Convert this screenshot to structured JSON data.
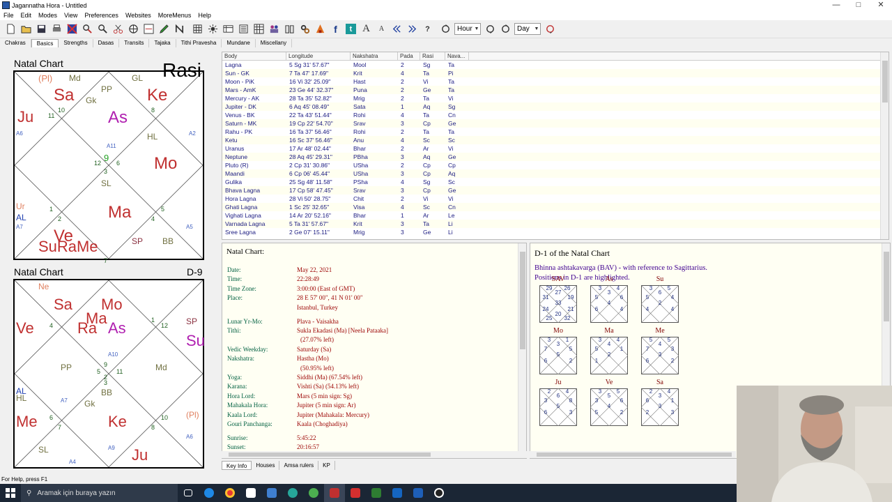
{
  "window": {
    "title": "Jagannatha Hora - Untitled",
    "controls": [
      "—",
      "□",
      "✕"
    ]
  },
  "menu": [
    "File",
    "Edit",
    "Modes",
    "View",
    "Preferences",
    "Websites",
    "MoreMenus",
    "Help"
  ],
  "toolbar": {
    "hour_combo": "Hour",
    "day_combo": "Day",
    "font_big": "A",
    "font_small": "A",
    "facebook": "f",
    "twitter": "t",
    "help": "?"
  },
  "tabs": [
    "Chakras",
    "Basics",
    "Strengths",
    "Dasas",
    "Transits",
    "Tajaka",
    "Tithi Pravesha",
    "Mundane",
    "Miscellany"
  ],
  "active_tab": "Basics",
  "chart1": {
    "title": "Natal Chart",
    "label": "Rasi",
    "planets": [
      {
        "t": "(Pl)",
        "c": "#e08060",
        "s": 13
      },
      {
        "t": "Md",
        "c": "#707040",
        "s": 12
      },
      {
        "t": "GL",
        "c": "#707040",
        "s": 12
      },
      {
        "t": "Sa",
        "c": "#c03030",
        "s": 24
      },
      {
        "t": "PP",
        "c": "#707040",
        "s": 12
      },
      {
        "t": "Ke",
        "c": "#c03030",
        "s": 24
      },
      {
        "t": "Gk",
        "c": "#707040",
        "s": 12
      },
      {
        "t": "As",
        "c": "#b020b0",
        "s": 24
      },
      {
        "t": "Ju",
        "c": "#c03030",
        "s": 22
      },
      {
        "t": "HL",
        "c": "#707040",
        "s": 12
      },
      {
        "t": "Mo",
        "c": "#c03030",
        "s": 24
      },
      {
        "t": "SL",
        "c": "#707040",
        "s": 12
      },
      {
        "t": "Ur",
        "c": "#e08060",
        "s": 12
      },
      {
        "t": "AL",
        "c": "#2040b0",
        "s": 12
      },
      {
        "t": "Ma",
        "c": "#c03030",
        "s": 24
      },
      {
        "t": "Ve",
        "c": "#c03030",
        "s": 24
      },
      {
        "t": "SuRaMe",
        "c": "#c03030",
        "s": 22
      },
      {
        "t": "SP",
        "c": "#8a3040",
        "s": 12
      },
      {
        "t": "BB",
        "c": "#707040",
        "s": 12
      },
      {
        "t": "A7",
        "c": "#4060c0",
        "s": 8
      },
      {
        "t": "A5",
        "c": "#4060c0",
        "s": 8
      },
      {
        "t": "A2",
        "c": "#4060c0",
        "s": 8
      },
      {
        "t": "A6",
        "c": "#4060c0",
        "s": 8
      },
      {
        "t": "A11",
        "c": "#4060c0",
        "s": 8
      }
    ],
    "houses": [
      "10",
      "11",
      "9",
      "12",
      "3",
      "6",
      "8",
      "1",
      "2",
      "4",
      "5",
      "7"
    ]
  },
  "chart2": {
    "title": "Natal Chart",
    "label": "D-9",
    "planets": [
      {
        "t": "Ne",
        "c": "#e08060",
        "s": 12
      },
      {
        "t": "Sa",
        "c": "#c03030",
        "s": 22
      },
      {
        "t": "Mo",
        "c": "#c03030",
        "s": 22
      },
      {
        "t": "Ma",
        "c": "#c03030",
        "s": 22
      },
      {
        "t": "Ve",
        "c": "#c03030",
        "s": 22
      },
      {
        "t": "Ra",
        "c": "#c03030",
        "s": 22
      },
      {
        "t": "As",
        "c": "#b020b0",
        "s": 22
      },
      {
        "t": "SP",
        "c": "#8a3040",
        "s": 12
      },
      {
        "t": "Su",
        "c": "#b020b0",
        "s": 22
      },
      {
        "t": "PP",
        "c": "#707040",
        "s": 12
      },
      {
        "t": "Md",
        "c": "#707040",
        "s": 12
      },
      {
        "t": "AL",
        "c": "#2040b0",
        "s": 12
      },
      {
        "t": "HL",
        "c": "#707040",
        "s": 12
      },
      {
        "t": "BB",
        "c": "#707040",
        "s": 12
      },
      {
        "t": "Gk",
        "c": "#707040",
        "s": 12
      },
      {
        "t": "Me",
        "c": "#c03030",
        "s": 22
      },
      {
        "t": "Ke",
        "c": "#c03030",
        "s": 22
      },
      {
        "t": "(Pl)",
        "c": "#e08060",
        "s": 12
      },
      {
        "t": "SL",
        "c": "#707040",
        "s": 12
      },
      {
        "t": "Ju",
        "c": "#c03030",
        "s": 22
      },
      {
        "t": "A10",
        "c": "#4060c0",
        "s": 8
      },
      {
        "t": "A7",
        "c": "#4060c0",
        "s": 8
      },
      {
        "t": "A9",
        "c": "#4060c0",
        "s": 8
      },
      {
        "t": "A4",
        "c": "#4060c0",
        "s": 8
      },
      {
        "t": "A6",
        "c": "#4060c0",
        "s": 8
      }
    ],
    "houses": [
      "4",
      "1",
      "12",
      "5",
      "2",
      "11",
      "8",
      "9",
      "6",
      "10",
      "7",
      "3"
    ]
  },
  "table": {
    "headers": [
      "Body",
      "Longitude",
      "Nakshatra",
      "Pada",
      "Rasi",
      "Nava..."
    ],
    "rows": [
      [
        "Lagna",
        "5 Sg 31' 57.67\"",
        "Mool",
        "2",
        "Sg",
        "Ta"
      ],
      [
        "Sun - GK",
        "7 Ta 47' 17.69\"",
        "Krit",
        "4",
        "Ta",
        "Pi"
      ],
      [
        "Moon - PiK",
        "16 Vi 32' 25.09\"",
        "Hast",
        "2",
        "Vi",
        "Ta"
      ],
      [
        "Mars - AmK",
        "23 Ge 44' 32.37\"",
        "Puna",
        "2",
        "Ge",
        "Ta"
      ],
      [
        "Mercury - AK",
        "28 Ta 35' 52.82\"",
        "Mrig",
        "2",
        "Ta",
        "Vi"
      ],
      [
        "Jupiter - DK",
        "6 Aq 45' 08.49\"",
        "Sata",
        "1",
        "Aq",
        "Sg"
      ],
      [
        "Venus - BK",
        "22 Ta 43' 51.44\"",
        "Rohi",
        "4",
        "Ta",
        "Cn"
      ],
      [
        "Saturn - MK",
        "19 Cp 22' 54.70\"",
        "Srav",
        "3",
        "Cp",
        "Ge"
      ],
      [
        "Rahu - PK",
        "16 Ta 37' 56.46\"",
        "Rohi",
        "2",
        "Ta",
        "Ta"
      ],
      [
        "Ketu",
        "16 Sc 37' 56.46\"",
        "Anu",
        "4",
        "Sc",
        "Sc"
      ],
      [
        "Uranus",
        "17 Ar 48' 02.44\"",
        "Bhar",
        "2",
        "Ar",
        "Vi"
      ],
      [
        "Neptune",
        "28 Aq 45' 29.31\"",
        "PBha",
        "3",
        "Aq",
        "Ge"
      ],
      [
        "Pluto (R)",
        "2 Cp 31' 30.86\"",
        "USha",
        "2",
        "Cp",
        "Cp"
      ],
      [
        "Maandi",
        "6 Cp 06' 45.44\"",
        "USha",
        "3",
        "Cp",
        "Aq"
      ],
      [
        "Gulika",
        "25 Sg 48' 11.58\"",
        "PSha",
        "4",
        "Sg",
        "Sc"
      ],
      [
        "Bhava Lagna",
        "17 Cp 58' 47.45\"",
        "Srav",
        "3",
        "Cp",
        "Ge"
      ],
      [
        "Hora Lagna",
        "28 Vi 50' 28.75\"",
        "Chit",
        "2",
        "Vi",
        "Vi"
      ],
      [
        "Ghati Lagna",
        "1 Sc 25' 32.65\"",
        "Visa",
        "4",
        "Sc",
        "Cn"
      ],
      [
        "Vighati Lagna",
        "14 Ar 20' 52.16\"",
        "Bhar",
        "1",
        "Ar",
        "Le"
      ],
      [
        "Varnada Lagna",
        "5 Ta 31' 57.67\"",
        "Krit",
        "3",
        "Ta",
        "Li"
      ],
      [
        "Sree Lagna",
        "2 Ge 07' 15.11\"",
        "Mrig",
        "3",
        "Ge",
        "Li"
      ]
    ]
  },
  "info": {
    "title": "Natal Chart:",
    "rows": [
      [
        "Date:",
        "May 22, 2021"
      ],
      [
        "Time:",
        "22:28:49"
      ],
      [
        "Time Zone:",
        "3:00:00 (East of GMT)"
      ],
      [
        "Place:",
        "28 E 57' 00\", 41 N 01' 00\""
      ],
      [
        "",
        "Istanbul, Turkey"
      ],
      [
        "Lunar Yr-Mo:",
        "Plava - Vaisakha"
      ],
      [
        "Tithi:",
        "Sukla Ekadasi (Ma) [Neela Pataaka]"
      ],
      [
        "",
        "(27.07% left)"
      ],
      [
        "Vedic Weekday:",
        "Saturday (Sa)"
      ],
      [
        "Nakshatra:",
        "Hastha (Mo)"
      ],
      [
        "",
        "(50.95% left)"
      ],
      [
        "Yoga:",
        "Siddhi (Ma) (67.54% left)"
      ],
      [
        "Karana:",
        "Vishti (Sa) (54.13% left)"
      ],
      [
        "Hora Lord:",
        "Mars (5 min sign: Sg)"
      ],
      [
        "Mahakala Hora:",
        "Jupiter (5 min sign: Ar)"
      ],
      [
        "Kaala Lord:",
        "Jupiter (Mahakala: Mercury)"
      ],
      [
        "Gouri Panchanga:",
        "Kaala (Choghadiya)"
      ],
      [
        "Sunrise:",
        "5:45:22"
      ],
      [
        "Sunset:",
        "20:16:57"
      ]
    ]
  },
  "d1": {
    "title": "D-1 of the Natal Chart",
    "desc1": "Bhinna ashtakavarga (BAV) - with reference to Sagittarius.",
    "desc2": "Positions in D-1 are highlighted.",
    "bav": [
      {
        "label": "SAV",
        "nums": [
          "27",
          "29",
          "26",
          "31",
          "19",
          "33",
          "24",
          "21",
          "20",
          "25",
          "32",
          "",
          ""
        ]
      },
      {
        "label": "As",
        "nums": [
          "3",
          "3",
          "4",
          "5",
          "6",
          "4",
          "6",
          "4",
          "",
          "",
          "",
          "",
          ""
        ]
      },
      {
        "label": "Su",
        "nums": [
          "6",
          "3",
          "5",
          "5",
          "4",
          "2",
          "4",
          "4",
          "",
          "",
          "",
          "",
          ""
        ]
      },
      {
        "label": "Mo",
        "nums": [
          "3",
          "3",
          "1",
          "7",
          "5",
          "5",
          "6",
          "2",
          "",
          "",
          "",
          "",
          ""
        ]
      },
      {
        "label": "Ma",
        "nums": [
          "4",
          "3",
          "4",
          "5",
          "1",
          "2",
          "1",
          "",
          "",
          "",
          "",
          "",
          ""
        ]
      },
      {
        "label": "Me",
        "nums": [
          "4",
          "5",
          "5",
          "7",
          "3",
          "3",
          "6",
          "2",
          "",
          "",
          "",
          "",
          ""
        ]
      },
      {
        "label": "Ju",
        "nums": [
          "6",
          "2",
          "4",
          "3",
          "8",
          "5",
          "6",
          "3",
          "",
          "",
          "",
          "",
          ""
        ]
      },
      {
        "label": "Ve",
        "nums": [
          "5",
          "3",
          "5",
          "3",
          "6",
          "4",
          "5",
          "2",
          "",
          "",
          "",
          "",
          ""
        ]
      },
      {
        "label": "Sa",
        "nums": [
          "3",
          "2",
          "4",
          "6",
          "1",
          "3",
          "2",
          "3",
          "",
          "",
          "",
          "",
          ""
        ]
      }
    ]
  },
  "bottom_tabs": [
    "Key Info",
    "Houses",
    "Amsa rulers",
    "KP"
  ],
  "status": "For Help, press F1",
  "taskbar": {
    "search": "Aramak için buraya yazın"
  }
}
